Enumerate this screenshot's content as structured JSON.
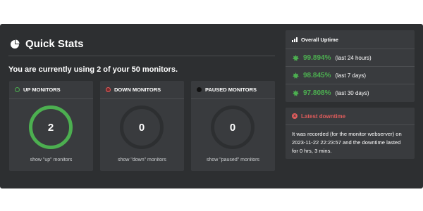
{
  "quick_stats": {
    "title": "Quick Stats",
    "usage_text": "You are currently using 2 of your 50 monitors."
  },
  "monitor_cards": [
    {
      "title": "UP MONITORS",
      "count": "2",
      "link": "show \"up\" monitors",
      "status_color": "#4caf50"
    },
    {
      "title": "DOWN MONITORS",
      "count": "0",
      "link": "show \"down\" monitors",
      "status_color": "#e05c5c"
    },
    {
      "title": "PAUSED MONITORS",
      "count": "0",
      "link": "show \"paused\" monitors",
      "status_color": "#111111"
    }
  ],
  "overall_uptime": {
    "title": "Overall Uptime",
    "rows": [
      {
        "percent": "99.894%",
        "period": "(last 24 hours)"
      },
      {
        "percent": "98.845%",
        "period": "(last 7 days)"
      },
      {
        "percent": "97.808%",
        "period": "(last 30 days)"
      }
    ]
  },
  "latest_downtime": {
    "title": "Latest downtime",
    "text": "It was recorded (for the monitor webserver) on 2023-11-22 22:23:57 and the downtime lasted for 0 hrs, 3 mins."
  },
  "colors": {
    "up": "#4caf50",
    "down": "#e05c5c",
    "panel": "#2d2f31",
    "card": "#393b3e"
  },
  "icons": {
    "quick_stats": "pie-chart-icon",
    "uptime": "bar-chart-icon",
    "uptime_row": "status-burst-icon",
    "downtime": "alert-icon"
  }
}
